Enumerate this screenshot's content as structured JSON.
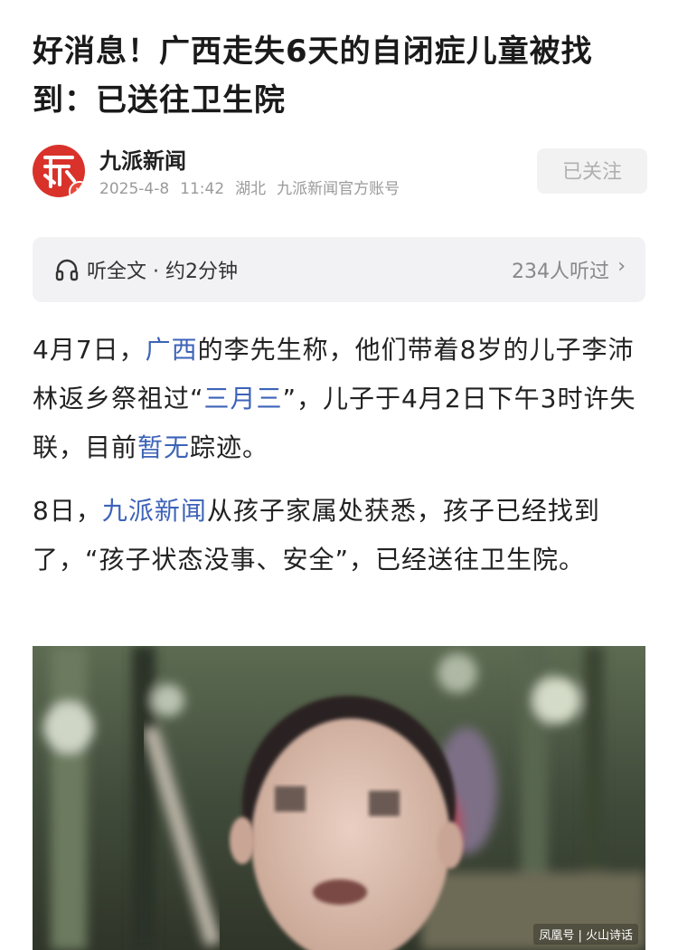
{
  "article": {
    "title": "好消息！广西走失6天的自闭症儿童被找到：已送往卫生院"
  },
  "source": {
    "name": "九派新闻",
    "date": "2025-4-8",
    "time": "11:42",
    "location": "湖北",
    "account": "九派新闻官方账号",
    "verified_badge": "V",
    "logo_icon": "jiupai-logo-icon",
    "follow_label": "已关注"
  },
  "listen": {
    "icon": "headphones-icon",
    "label": "听全文 · 约2分钟",
    "count": "234人听过",
    "chevron": "›"
  },
  "paragraphs": {
    "p1": {
      "s1": "4月7日，",
      "l1": "广西",
      "s2": "的李先生称，他们带着8岁的儿子李沛林返乡祭祖过“",
      "l2": "三月三",
      "s3": "”，儿子于4月2日下午3时许失联，目前",
      "l3": "暂无",
      "s4": "踪迹。"
    },
    "p2": {
      "s1": "8日，",
      "l1": "九派新闻",
      "s2": "从孩子家属处获悉，孩子已经找到了，“孩子状态没事、安全”，已经送往卫生院。"
    }
  },
  "photo": {
    "description_icon": "photo-icon",
    "watermark": "凤凰号 | 火山诗话"
  },
  "colors": {
    "link": "#3d63b8",
    "brand_red": "#d9322b",
    "listen_bg": "#f2f2f4",
    "follow_bg": "#f2f2f2"
  }
}
